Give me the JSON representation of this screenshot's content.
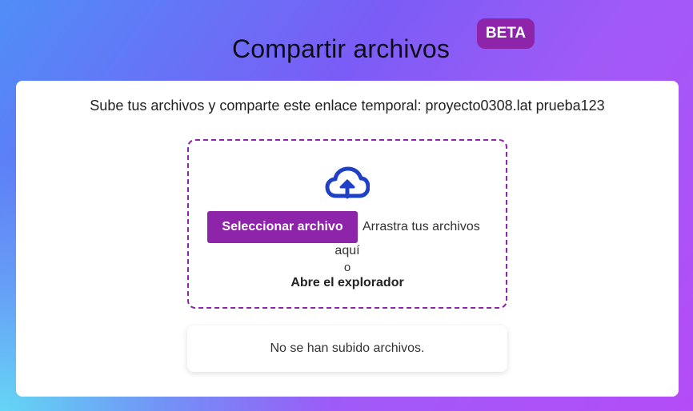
{
  "header": {
    "title": "Compartir archivos",
    "badge": "BETA"
  },
  "card": {
    "subtitle": "Sube tus archivos y comparte este enlace temporal: proyecto0308.lat prueba123"
  },
  "dropzone": {
    "icon": "cloud-upload-icon",
    "select_button_label": "Seleccionar archivo",
    "drag_text_line1": "Arrastra tus archivos",
    "drag_text_line2": "aquí",
    "or_text": "o",
    "explorer_link": "Abre el explorador"
  },
  "files": {
    "empty_message": "No se han subido archivos."
  },
  "colors": {
    "accent": "#8e24aa",
    "icon": "#1e3fc8",
    "background_start": "#4f8ef7",
    "background_end": "#b44cf8"
  }
}
